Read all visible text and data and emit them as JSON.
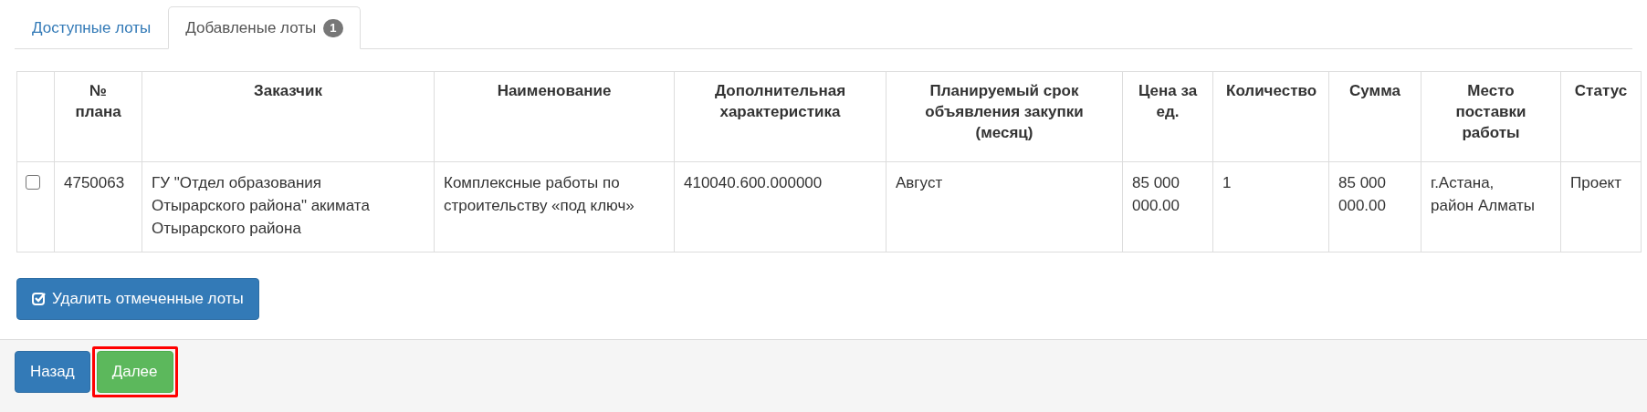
{
  "tabs": [
    {
      "label": "Доступные лоты",
      "selected": false
    },
    {
      "label": "Добавленые лоты",
      "badge": "1",
      "selected": true
    }
  ],
  "table": {
    "columns": [
      "№ плана",
      "Заказчик",
      "Наименование",
      "Дополнительная характеристика",
      "Планируемый срок объявления закупки (месяц)",
      "Цена за ед.",
      "Количество",
      "Сумма",
      "Место поставки работы",
      "Статус"
    ],
    "rows": [
      {
        "checked": false,
        "cells": [
          "4750063",
          "ГУ \"Отдел образования Отырарского района\" акимата Отырарского района",
          "Комплексные работы по строительству «под ключ»",
          "410040.600.000000",
          "Август",
          "85 000 000.00",
          "1",
          "85 000 000.00",
          "г.Астана, район Алматы",
          "Проект"
        ]
      }
    ]
  },
  "delete_button": {
    "label": "Удалить отмеченные лоты"
  },
  "footer_buttons": [
    {
      "label": "Назад",
      "kind": "primary",
      "highlighted": false
    },
    {
      "label": "Далее",
      "kind": "success",
      "highlighted": true
    }
  ]
}
